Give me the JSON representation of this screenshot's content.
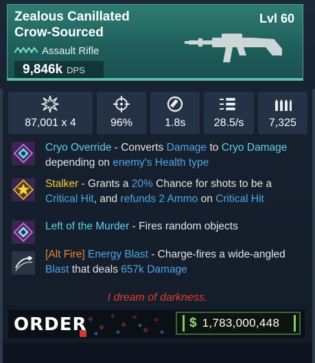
{
  "weapon": {
    "name": "Zealous Canillated\nCrow-Sourced",
    "level": "Lvl 60",
    "type": "Assault Rifle",
    "dps_value": "9,846k",
    "dps_unit": "DPS"
  },
  "stats": [
    {
      "icon": "damage-burst-icon",
      "value": "87,001 x 4"
    },
    {
      "icon": "crosshair-icon",
      "value": "96%"
    },
    {
      "icon": "reload-timer-icon",
      "value": "1.8s"
    },
    {
      "icon": "fire-rate-bullets-icon",
      "value": "28.5/s"
    },
    {
      "icon": "ammo-icon",
      "value": "7,325"
    }
  ],
  "perks": [
    {
      "icon": "cryo-diamond-icon",
      "segments": [
        {
          "t": "Cryo Override",
          "c": "cyan"
        },
        {
          "t": " - Converts ",
          "c": "white"
        },
        {
          "t": "Damage",
          "c": "blue"
        },
        {
          "t": " to ",
          "c": "white"
        },
        {
          "t": "Cryo Damage",
          "c": "cyan"
        },
        {
          "t": " depending on ",
          "c": "white"
        },
        {
          "t": "enemy's Health type",
          "c": "blue"
        }
      ]
    },
    {
      "icon": "stalker-star-icon",
      "segments": [
        {
          "t": "Stalker",
          "c": "yellow"
        },
        {
          "t": " - Grants a ",
          "c": "white"
        },
        {
          "t": "20%",
          "c": "blue"
        },
        {
          "t": " Chance for shots to be a ",
          "c": "white"
        },
        {
          "t": "Critical Hit",
          "c": "blue"
        },
        {
          "t": ", and ",
          "c": "white"
        },
        {
          "t": "refunds 2 Ammo",
          "c": "blue"
        },
        {
          "t": " on ",
          "c": "white"
        },
        {
          "t": "Critical Hit",
          "c": "blue"
        }
      ]
    },
    {
      "icon": "random-objects-diamond-icon",
      "segments": [
        {
          "t": "Left of the Murder",
          "c": "cyan"
        },
        {
          "t": " - Fires random objects",
          "c": "white"
        }
      ]
    },
    {
      "icon": "energy-blast-icon",
      "segments": [
        {
          "t": "[Alt Fire]",
          "c": "orange"
        },
        {
          "t": " ",
          "c": "white"
        },
        {
          "t": "Energy Blast",
          "c": "blue"
        },
        {
          "t": " - Charge-fires a wide-angled ",
          "c": "white"
        },
        {
          "t": "Blast",
          "c": "blue"
        },
        {
          "t": " that deals ",
          "c": "white"
        },
        {
          "t": "657k Damage",
          "c": "blue"
        }
      ]
    }
  ],
  "flavor_text": "I dream of darkness.",
  "brand": "ORDER",
  "price": {
    "currency_symbol": "$",
    "value": "1,783,000,448"
  },
  "colors": {
    "header_teal": "#2f7c72",
    "cyan": "#5fd3ea",
    "yellow": "#f2d33c",
    "blue": "#4fa6e8",
    "orange": "#e88a3a",
    "flavor_red": "#e23c3c",
    "price_green": "#7fd06a"
  }
}
